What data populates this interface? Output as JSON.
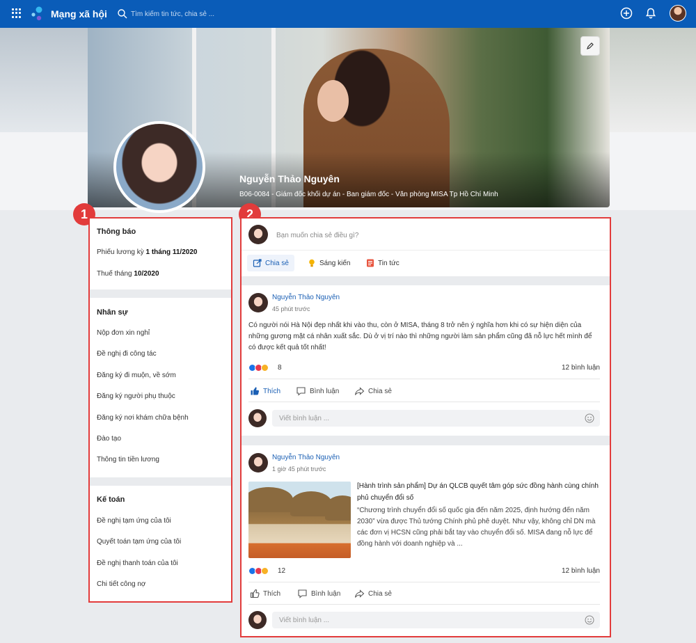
{
  "app": {
    "title": "Mạng xã hội"
  },
  "search": {
    "placeholder": "Tìm kiếm tin tức, chia sẻ ..."
  },
  "profile": {
    "name": "Nguyễn Thảo Nguyên",
    "subtitle": "B06-0084 - Giám đốc khối dự án  - Ban giám đốc - Văn phòng MISA Tp Hồ Chí Minh"
  },
  "badges": {
    "left": "1",
    "right": "2"
  },
  "left_panel": {
    "notifications": {
      "title": "Thông báo",
      "items": [
        {
          "prefix": "Phiếu lương kỳ ",
          "bold": "1 tháng 11/2020"
        },
        {
          "prefix": "Thuế tháng ",
          "bold": "10/2020"
        }
      ]
    },
    "hr": {
      "title": "Nhân sự",
      "items": [
        "Nộp đơn xin nghỉ",
        "Đề nghị đi công tác",
        "Đăng ký đi muộn, về sớm",
        "Đăng ký người phụ thuộc",
        "Đăng ký nơi khám chữa bệnh",
        "Đào tạo",
        "Thông tin tiền lương"
      ]
    },
    "accounting": {
      "title": "Kế toán",
      "items": [
        "Đề nghị tạm ứng của tôi",
        "Quyết toán tạm ứng của tôi",
        "Đề nghị thanh toán của tôi",
        "Chi tiết công nợ"
      ]
    }
  },
  "compose": {
    "placeholder": "Bạn muốn chia sẻ điều gì?",
    "tabs": [
      "Chia sẻ",
      "Sáng kiến",
      "Tin tức"
    ]
  },
  "posts": [
    {
      "author": "Nguyễn Thảo Nguyên",
      "time": "45  phút trước",
      "text": "Có người nói Hà Nội đẹp nhất khi vào thu, còn ở MISA, tháng 8 trở nên ý nghĩa hơn khi có sự hiện diện của những gương mặt cá nhân xuất sắc. Dù ở vị trí nào thì những người làm sản phẩm cũng đã nỗ lực hết mình để có được kết quả tốt nhất!",
      "reactions": "8",
      "comments": "12 bình luận",
      "like": "Thích",
      "comment": "Bình luận",
      "share": "Chia sẻ",
      "comment_placeholder": "Viết bình luận ..."
    },
    {
      "author": "Nguyễn Thảo Nguyên",
      "time": "1 giờ 45 phút trước",
      "article_title": "[Hành trình sản phẩm] Dự án QLCB quyết tâm góp sức đồng hành cùng chính phủ chuyển đổi số",
      "article_desc": "“Chương trình chuyển đổi số quốc gia đến năm 2025, định hướng đến năm 2030” vừa được Thủ tướng Chính phủ phê duyệt. Như vậy, không chỉ DN mà các đơn vị HCSN cũng phải bắt tay vào chuyển đổi số. MISA đang nỗ lực để đồng hành với doanh nghiệp và ...",
      "reactions": "12",
      "comments": "12 bình luận",
      "like": "Thích",
      "comment": "Bình luận",
      "share": "Chia sẻ",
      "comment_placeholder": "Viết bình luận ..."
    }
  ],
  "colors": {
    "brand": "#0a5cb8",
    "highlight": "#e23b3b",
    "link": "#1a5fb4"
  }
}
